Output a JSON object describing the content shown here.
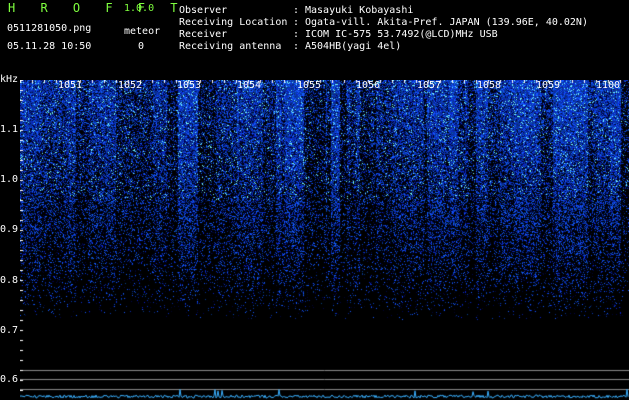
{
  "app": {
    "brand": "H R O F F T",
    "version": "1.0.0"
  },
  "file": {
    "name": "0511281050.png",
    "datetime": "05.11.28 10:50"
  },
  "meteor": {
    "label": "meteor",
    "count": "0"
  },
  "info": [
    {
      "key": "Observer",
      "value": "Masayuki Kobayashi"
    },
    {
      "key": "Receiving Location",
      "value": "Ogata-vill. Akita-Pref. JAPAN (139.96E, 40.02N)"
    },
    {
      "key": "Receiver",
      "value": "ICOM IC-575 53.7492(@LCD)MHz USB"
    },
    {
      "key": "Receiving antenna",
      "value": "A504HB(yagi 4el)"
    }
  ],
  "separator": ":",
  "yaxis": {
    "unit": "kHz",
    "ticks": [
      "1.1",
      "1.0",
      "0.9",
      "0.8",
      "0.7",
      "0.6"
    ]
  },
  "xaxis": {
    "ticks": [
      "1051",
      "1052",
      "1053",
      "1054",
      "1055",
      "1056",
      "1057",
      "1058",
      "1059",
      "1100"
    ]
  },
  "colors": {
    "label_green": "#7fff3f",
    "label_white": "#ffffff",
    "spectrum_blue": "#1e46ff",
    "trace_cyan": "#3ab0ff"
  }
}
